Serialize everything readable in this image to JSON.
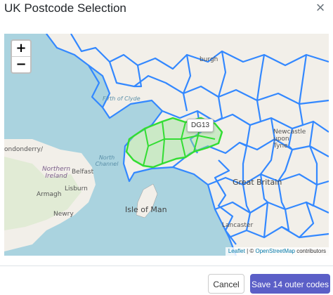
{
  "modal": {
    "title": "UK Postcode Selection",
    "close_glyph": "×"
  },
  "map": {
    "zoom_in": "+",
    "zoom_out": "−",
    "tooltip": "DG13",
    "attribution": {
      "leaflet": "Leaflet",
      "separator": " | © ",
      "osm": "OpenStreetMap",
      "contributors": " contributors"
    },
    "labels": {
      "edinburgh": "burgh",
      "firth_of_clyde": "Firth of Clyde",
      "north_channel": "North Channel",
      "londonderry": "ondonderry/",
      "northern_ireland": "Northern Ireland",
      "belfast": "Belfast",
      "lisburn": "Lisburn",
      "armagh": "Armagh",
      "newry": "Newry",
      "isle_of_man": "Isle of Man",
      "great_britain": "Great Britain",
      "newcastle": "Newcastle upon Tyne",
      "lancaster": "Lancaster"
    },
    "colors": {
      "sea": "#aad3df",
      "land": "#f2efe9",
      "boundary": "#3388ff",
      "selected": "#33dd33"
    }
  },
  "footer": {
    "cancel_label": "Cancel",
    "save_label": "Save 14 outer codes"
  }
}
